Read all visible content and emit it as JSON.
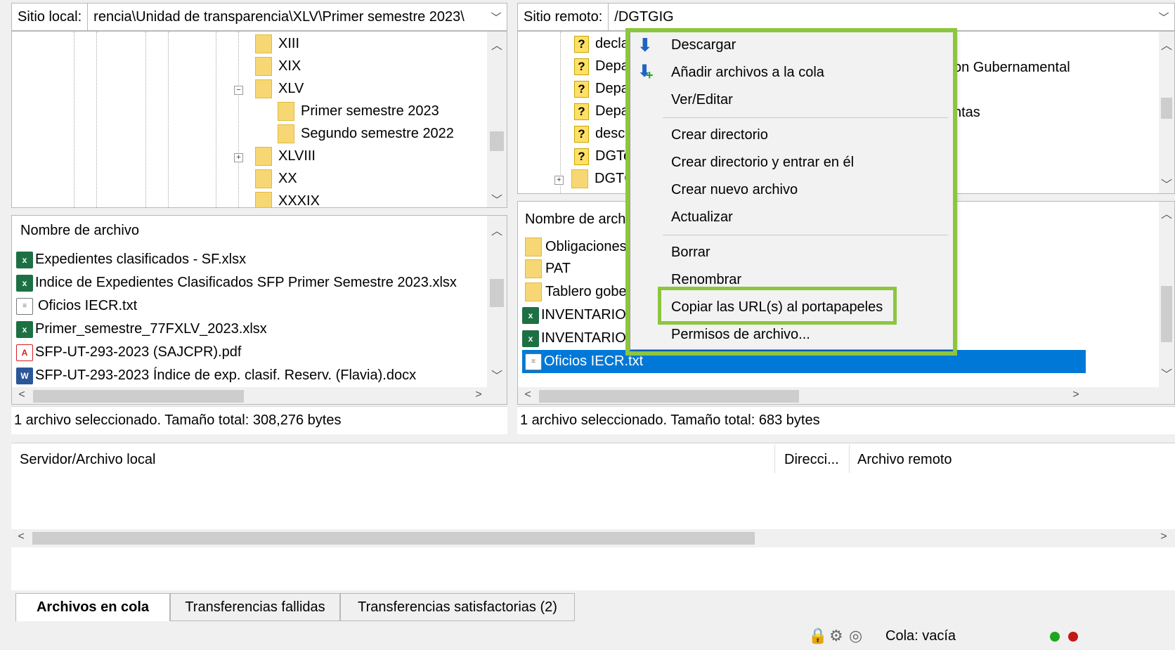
{
  "local": {
    "path_label": "Sitio local:",
    "path_value": "rencia\\Unidad de transparencia\\XLV\\Primer semestre 2023\\",
    "tree": [
      "XIII",
      "XIX",
      "XLV",
      "Primer semestre 2023",
      "Segundo semestre 2022",
      "XLVIII",
      "XX",
      "XXXIX"
    ],
    "list_header": "Nombre de archivo",
    "files": [
      {
        "name": "Expedientes clasificados - SF.xlsx",
        "icon": "excel-file-icon"
      },
      {
        "name": "Indice de Expedientes Clasificados SFP Primer Semestre 2023.xlsx",
        "icon": "excel-file-icon"
      },
      {
        "name": "Oficios IECR.txt",
        "icon": "text-file-icon"
      },
      {
        "name": "Primer_semestre_77FXLV_2023.xlsx",
        "icon": "excel-file-icon"
      },
      {
        "name": "SFP-UT-293-2023 (SAJCPR).pdf",
        "icon": "pdf-file-icon"
      },
      {
        "name": "SFP-UT-293-2023 Índice de exp. clasif. Reserv. (Flavia).docx",
        "icon": "word-file-icon"
      }
    ],
    "status": "1 archivo seleccionado. Tamaño total: 308,276 bytes"
  },
  "remote": {
    "path_label": "Sitio remoto:",
    "path_value": "/DGTGIG",
    "tree": [
      "decla",
      "Depa",
      "Depa",
      "Depa",
      "desc",
      "DGTe",
      "DGTC"
    ],
    "tree_right_texts": [
      "on Gubernamental",
      "ntas"
    ],
    "list_header": "Nombre de arch",
    "files": [
      {
        "name": "Obligaciones",
        "icon": "folder-icon"
      },
      {
        "name": "PAT",
        "icon": "folder-icon"
      },
      {
        "name": "Tablero gobe",
        "icon": "folder-icon"
      },
      {
        "name": "INVENTARIO",
        "icon": "excel-file-icon"
      },
      {
        "name": "INVENTARIO",
        "icon": "excel-file-icon"
      },
      {
        "name": "Oficios IECR.txt",
        "icon": "text-file-icon"
      }
    ],
    "status": "1 archivo seleccionado. Tamaño total: 683 bytes"
  },
  "context_menu": {
    "items": [
      "Descargar",
      "Añadir archivos a la cola",
      "Ver/Editar",
      "Crear directorio",
      "Crear directorio y entrar en él",
      "Crear nuevo archivo",
      "Actualizar",
      "Borrar",
      "Renombrar",
      "Copiar las URL(s) al portapapeles",
      "Permisos de archivo..."
    ],
    "highlight_color": "#8cc63f"
  },
  "queue": {
    "col_local": "Servidor/Archivo local",
    "col_direction": "Direcci...",
    "col_remote": "Archivo remoto"
  },
  "tabs": [
    "Archivos en cola",
    "Transferencias fallidas",
    "Transferencias satisfactorias (2)"
  ],
  "statusbar": {
    "queue_text": "Cola: vacía"
  },
  "colors": {
    "selection": "#0078d7",
    "folder": "#f7d774"
  }
}
